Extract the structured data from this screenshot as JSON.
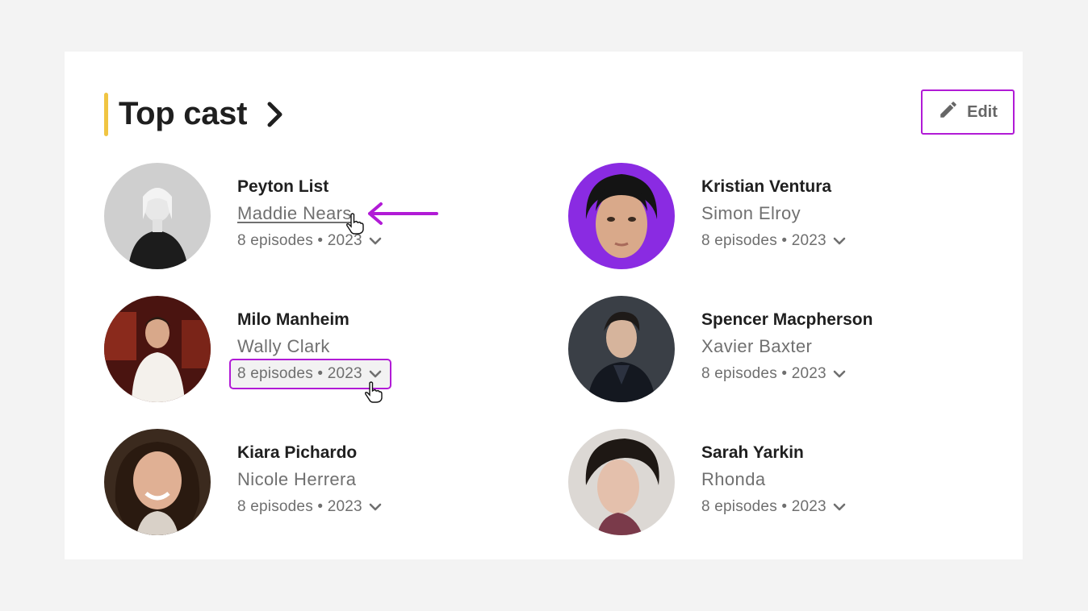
{
  "section": {
    "title": "Top cast",
    "edit_label": "Edit",
    "accent_color": "#f0c542",
    "highlight_color": "#b11bd6"
  },
  "cast": [
    {
      "actor": "Peyton List",
      "character": "Maddie Nears",
      "episodes": "8 episodes • 2023",
      "avatar_bg": "#c8c8c8"
    },
    {
      "actor": "Kristian Ventura",
      "character": "Simon Elroy",
      "episodes": "8 episodes • 2023",
      "avatar_bg": "#8a2be2"
    },
    {
      "actor": "Milo Manheim",
      "character": "Wally Clark",
      "episodes": "8 episodes • 2023",
      "avatar_bg": "#5a1a14"
    },
    {
      "actor": "Spencer Macpherson",
      "character": "Xavier Baxter",
      "episodes": "8 episodes • 2023",
      "avatar_bg": "#3a3f46"
    },
    {
      "actor": "Kiara Pichardo",
      "character": "Nicole Herrera",
      "episodes": "8 episodes • 2023",
      "avatar_bg": "#3b2a1e"
    },
    {
      "actor": "Sarah Yarkin",
      "character": "Rhonda",
      "episodes": "8 episodes • 2023",
      "avatar_bg": "#d8d4d0"
    }
  ]
}
